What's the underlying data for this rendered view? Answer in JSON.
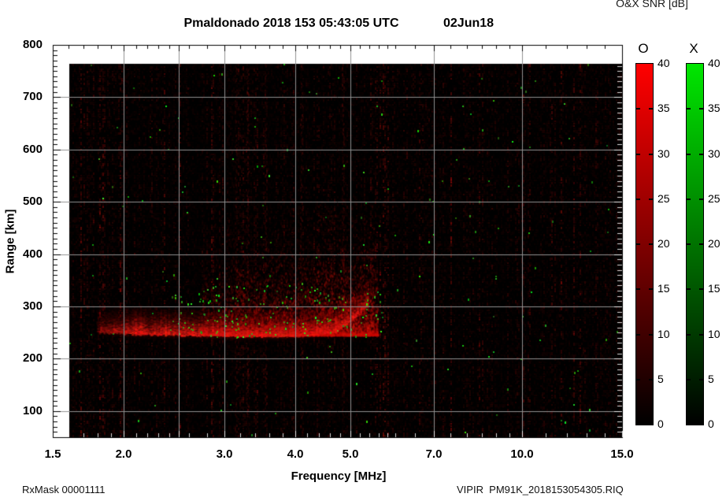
{
  "header": {
    "title": "Pmaldonado 2018 153 05:43:05 UTC",
    "date": "02Jun18",
    "colorbar_title": "O&X SNR [dB]"
  },
  "footer": {
    "rx_mask": "RxMask 00001111",
    "file_label": "VIPIR  PM91K_2018153054305.RIQ"
  },
  "chart_data": {
    "type": "heatmap",
    "title": "Pmaldonado 2018 153 05:43:05 UTC",
    "date_label": "02Jun18",
    "description": "VIPIR ionogram: O-mode echoes in red, X-mode echoes in green over black background",
    "xlabel": "Frequency [MHz]",
    "ylabel": "Range [km]",
    "x_scale": "log",
    "xlim": [
      1.5,
      15.0
    ],
    "ylim": [
      50,
      800
    ],
    "x_ticks": {
      "values": [
        1.5,
        2.0,
        3.0,
        4.0,
        5.0,
        7.0,
        10.0,
        15.0
      ],
      "labels": [
        "1.5",
        "2.0",
        "3.0",
        "4.0",
        "5.0",
        "7.0",
        "10.0",
        "15.0"
      ]
    },
    "x_minor_ticks": [
      1.6,
      1.7,
      1.8,
      1.9,
      2.1,
      2.2,
      2.3,
      2.4,
      2.6,
      2.8,
      3.2,
      3.4,
      3.6,
      3.8,
      4.2,
      4.4,
      4.6,
      4.8,
      5.2,
      5.4,
      5.6,
      5.8,
      6.0,
      6.5,
      7.5,
      8.0,
      8.5,
      9.0,
      9.5,
      11.0,
      12.0,
      13.0,
      14.0
    ],
    "x_gridlines": [
      2.0,
      2.5,
      3.0,
      4.0,
      5.0,
      7.0,
      10.0
    ],
    "y_ticks": {
      "major_interval_km": 100,
      "minor_interval_km": 10,
      "labels_top_to_bottom": [
        "800",
        "700",
        "600",
        "500",
        "400",
        "300",
        "200",
        "100"
      ]
    },
    "grid": true,
    "grid_color": "#909090",
    "plot_background": "#000000",
    "colorbar": {
      "title": "O&X SNR [dB]",
      "min": 0,
      "max": 40,
      "tick_step": 5,
      "tick_labels_top_to_bottom": [
        "40",
        "35",
        "30",
        "25",
        "20",
        "15",
        "10",
        "5",
        "0"
      ],
      "bars": [
        {
          "label": "O",
          "top_color": "#ff0000",
          "bottom_color": "#000000"
        },
        {
          "label": "X",
          "top_color": "#00e600",
          "bottom_color": "#000000"
        }
      ]
    },
    "data_extent": {
      "freq_mhz": [
        1.6,
        15.0
      ],
      "range_km": [
        55,
        765
      ]
    },
    "features": {
      "background_noise": "faint dark-red vertical striations across entire raster",
      "f_trace_bottom_edge": [
        [
          1.8,
          252
        ],
        [
          2.1,
          248
        ],
        [
          2.6,
          246
        ],
        [
          3.2,
          244
        ],
        [
          3.8,
          244
        ],
        [
          4.3,
          246
        ],
        [
          4.7,
          252
        ],
        [
          5.0,
          272
        ],
        [
          5.2,
          288
        ],
        [
          5.35,
          302
        ]
      ],
      "spread_f_region": {
        "freq_mhz": [
          2.75,
          5.6
        ],
        "range_km": [
          245,
          510
        ]
      },
      "interference_columns_mhz": [
        3.15,
        3.3,
        3.55,
        4.1,
        4.85
      ],
      "x_mode_speckle": "sparse bright green pixels, densest within the echo trace region"
    }
  }
}
